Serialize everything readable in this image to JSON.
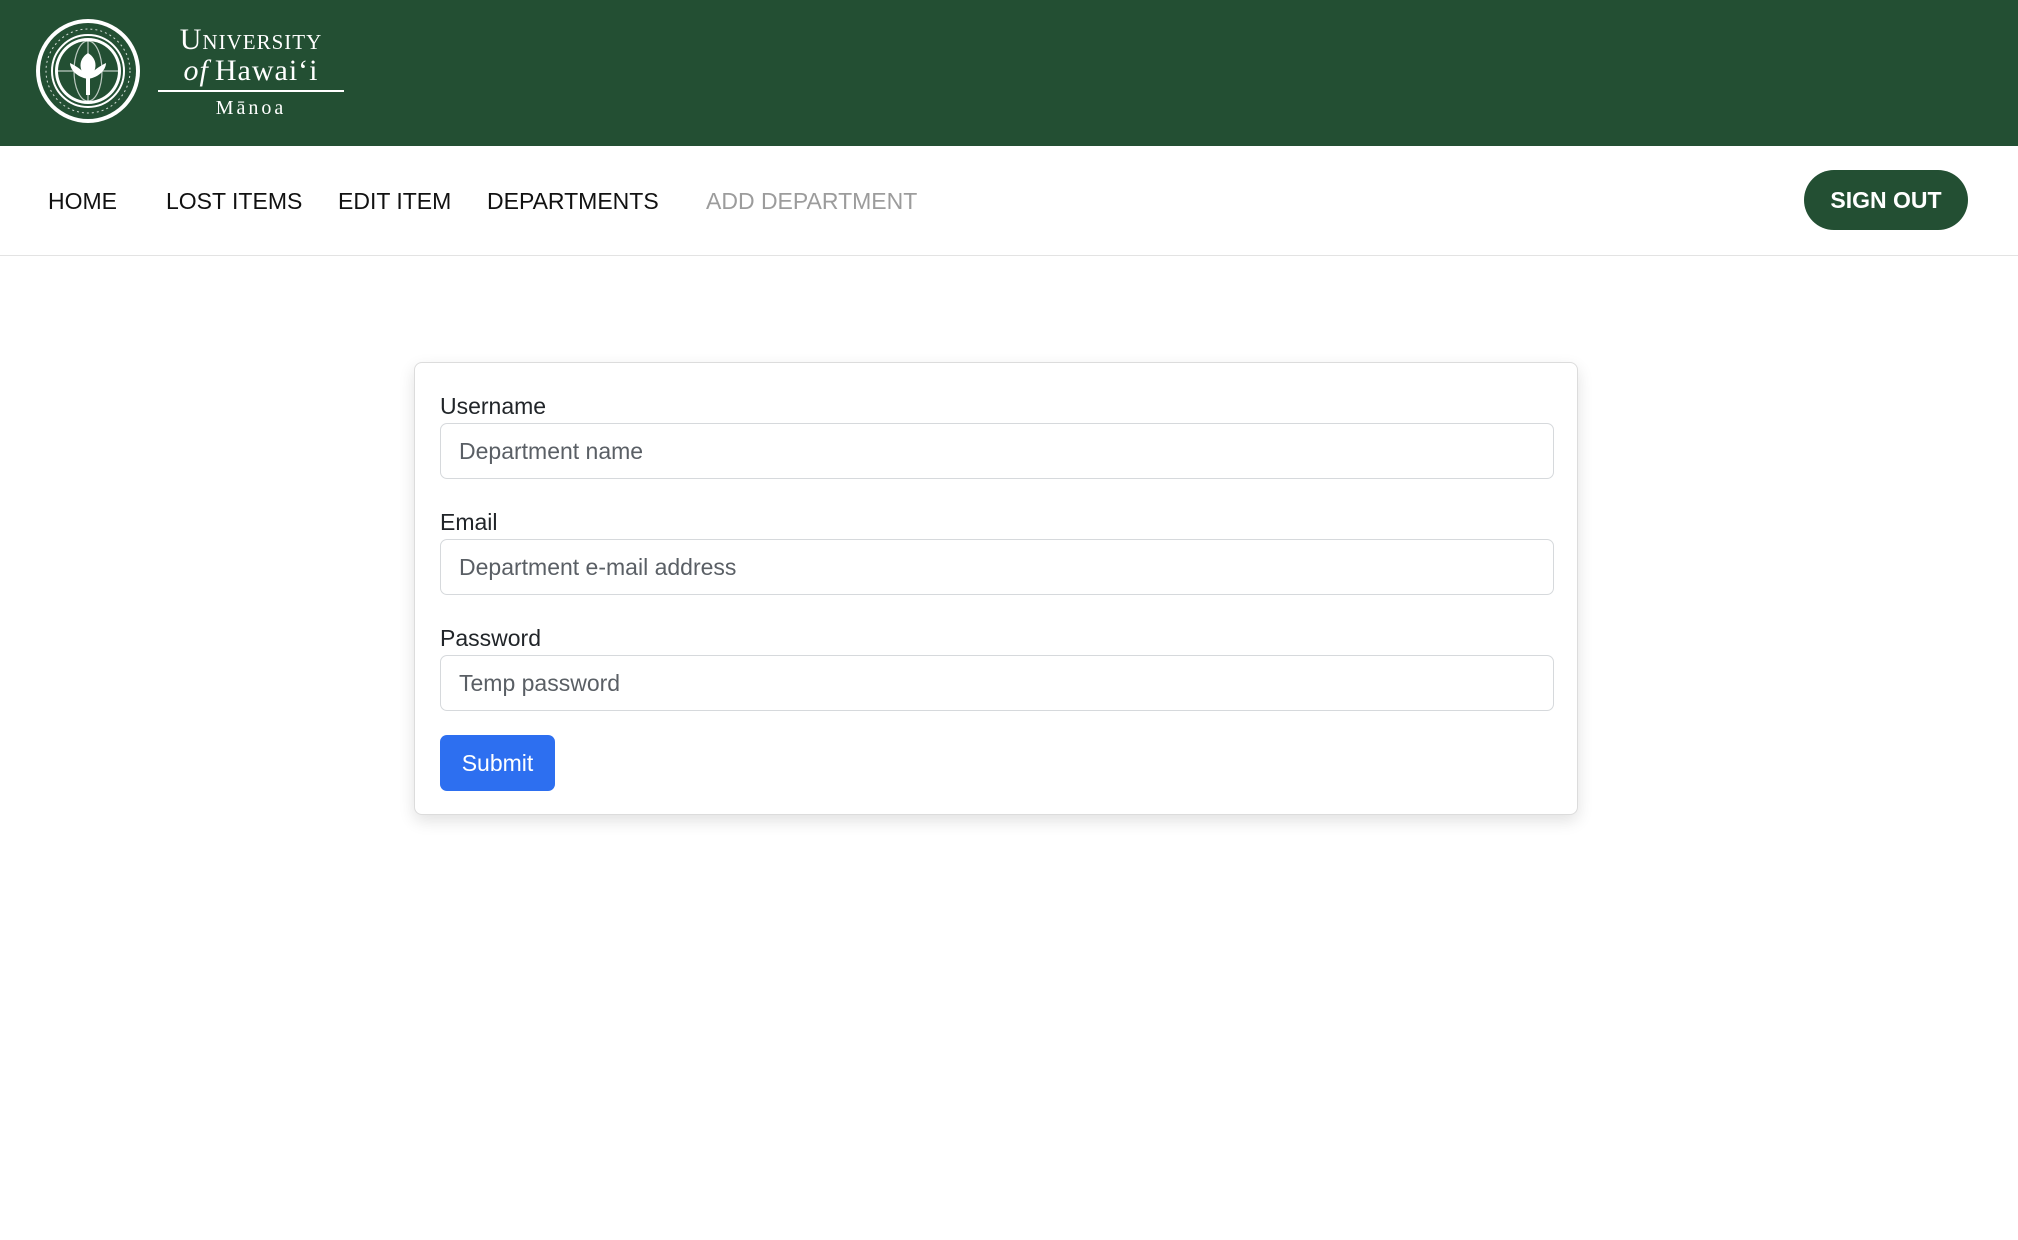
{
  "header": {
    "wordmark": {
      "line1": "University",
      "line2_of": "of",
      "line2_rest": "Hawaiʻi",
      "line3": "Mānoa"
    },
    "seal_icon": "university-seal-icon",
    "banner_color": "#234f33"
  },
  "nav": {
    "items": [
      {
        "label": "HOME"
      },
      {
        "label": "LOST ITEMS"
      },
      {
        "label": "EDIT ITEM"
      },
      {
        "label": "DEPARTMENTS"
      },
      {
        "label": "ADD DEPARTMENT",
        "state": "disabled"
      }
    ],
    "signout_label": "SIGN OUT"
  },
  "form": {
    "username": {
      "label": "Username",
      "placeholder": "Department name",
      "value": ""
    },
    "email": {
      "label": "Email",
      "placeholder": "Department e-mail address",
      "value": ""
    },
    "password": {
      "label": "Password",
      "placeholder": "Temp password",
      "value": ""
    },
    "submit_label": "Submit"
  },
  "colors": {
    "brand_green": "#234f33",
    "primary_blue": "#2d6ff0",
    "disabled_text": "#9c9c9c"
  }
}
